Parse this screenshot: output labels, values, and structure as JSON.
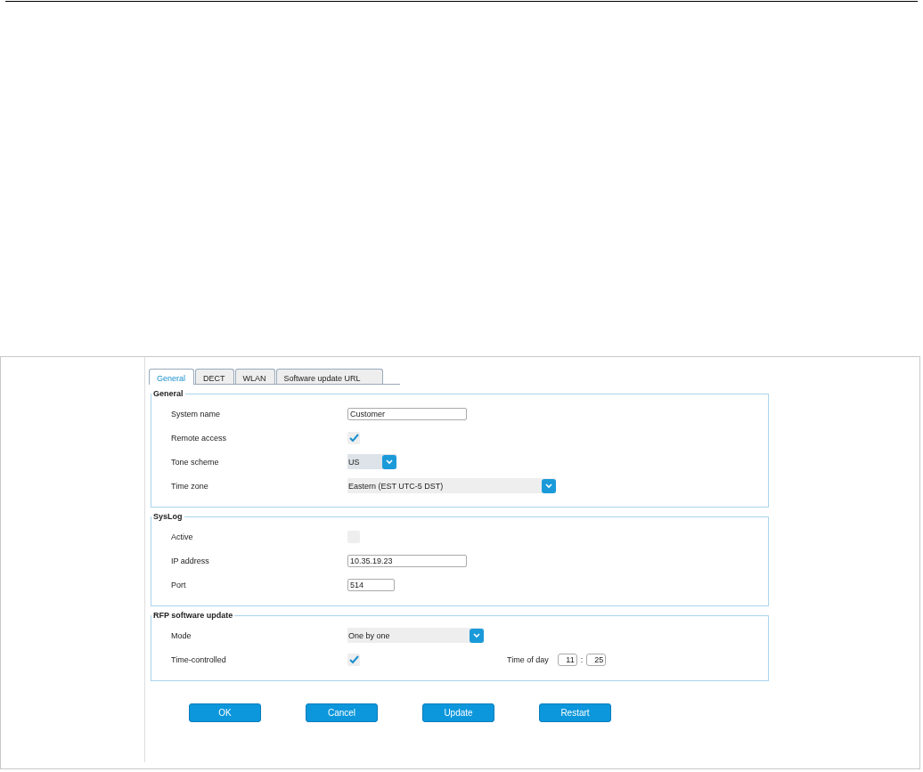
{
  "tabs": [
    {
      "label": "General",
      "selected": true
    },
    {
      "label": "DECT",
      "selected": false
    },
    {
      "label": "WLAN",
      "selected": false
    },
    {
      "label": "Software update URL",
      "selected": false
    }
  ],
  "sections": [
    {
      "title": "General",
      "rows": [
        {
          "kind": "text",
          "label": "System name",
          "value": "Customer"
        },
        {
          "kind": "checkbox",
          "label": "Remote access",
          "checked": true
        },
        {
          "kind": "select",
          "label": "Tone scheme",
          "value": "US"
        },
        {
          "kind": "select",
          "label": "Time zone",
          "value": "Eastern (EST UTC-5 DST)"
        }
      ]
    },
    {
      "title": "SysLog",
      "rows": [
        {
          "kind": "checkbox",
          "label": "Active",
          "checked": false
        },
        {
          "kind": "text",
          "label": "IP address",
          "value": "10.35.19.23"
        },
        {
          "kind": "text",
          "label": "Port",
          "value": "514"
        }
      ]
    },
    {
      "title": "RFP software update",
      "rows": [
        {
          "kind": "select",
          "label": "Mode",
          "value": "One by one"
        },
        {
          "kind": "checkbox",
          "label": "Time-controlled",
          "checked": true,
          "time": {
            "label": "Time of day",
            "hour": "11",
            "separator": ":",
            "minute": "25"
          }
        }
      ]
    }
  ],
  "buttons": [
    "OK",
    "Cancel",
    "Update",
    "Restart"
  ]
}
